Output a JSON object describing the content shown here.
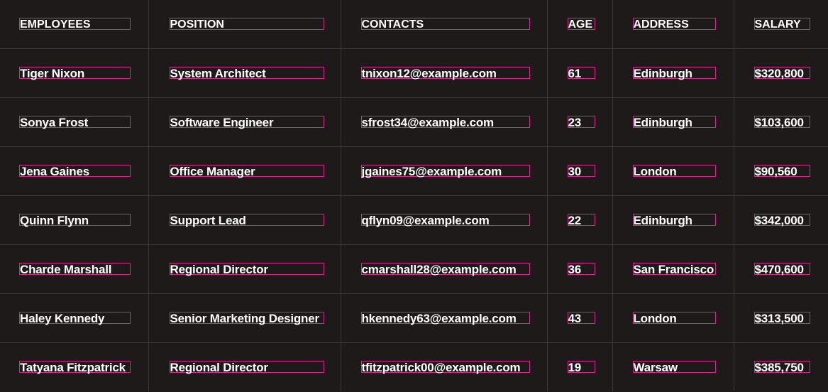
{
  "table": {
    "headers": [
      "EMPLOYEES",
      "POSITION",
      "CONTACTS",
      "AGE",
      "ADDRESS",
      "SALARY"
    ],
    "rows": [
      [
        "Tiger Nixon",
        "System Architect",
        "tnixon12@example.com",
        "61",
        "Edinburgh",
        "$320,800"
      ],
      [
        "Sonya Frost",
        "Software Engineer",
        "sfrost34@example.com",
        "23",
        "Edinburgh",
        "$103,600"
      ],
      [
        "Jena Gaines",
        "Office Manager",
        "jgaines75@example.com",
        "30",
        "London",
        "$90,560"
      ],
      [
        "Quinn Flynn",
        "Support Lead",
        "qflyn09@example.com",
        "22",
        "Edinburgh",
        "$342,000"
      ],
      [
        "Charde Marshall",
        "Regional Director",
        "cmarshall28@example.com",
        "36",
        "San Francisco",
        "$470,600"
      ],
      [
        "Haley Kennedy",
        "Senior Marketing Designer",
        "hkennedy63@example.com",
        "43",
        "London",
        "$313,500"
      ],
      [
        "Tatyana Fitzpatrick",
        "Regional Director",
        "tfitzpatrick00@example.com",
        "19",
        "Warsaw",
        "$385,750"
      ]
    ]
  },
  "colors": {
    "background": "#1e1a1a",
    "grid_line": "#3c3838",
    "text": "#ffffff",
    "outline": "#d42a8c"
  }
}
